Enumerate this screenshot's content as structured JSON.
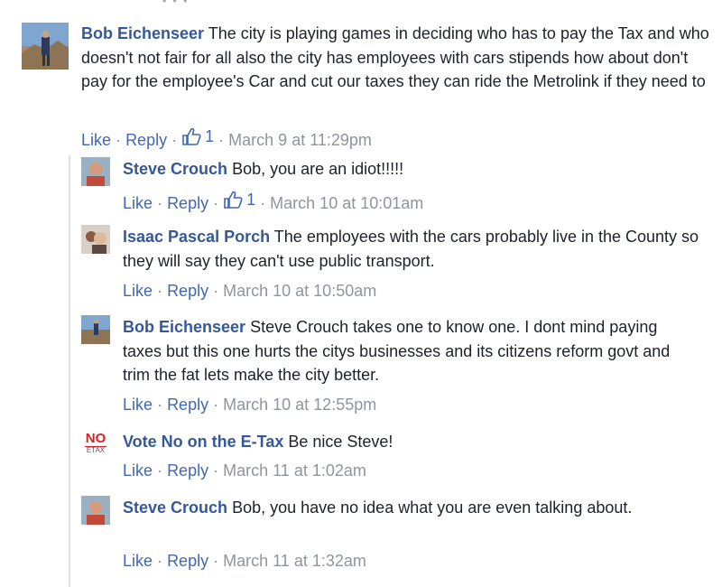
{
  "comments": [
    {
      "name": "Bob Eichenseer",
      "text": "The city is playing games in deciding who has to pay the Tax and who doesn't not fair for all also the city has employees with cars stipends how about don't pay for the employee's Car and cut our taxes they can ride the Metrolink if they need to",
      "like": "Like",
      "reply": "Reply",
      "reactions": "1",
      "time": "March 9 at 11:29pm"
    }
  ],
  "replies": [
    {
      "name": "Steve Crouch",
      "text": "Bob, you are an idiot!!!!!",
      "like": "Like",
      "reply": "Reply",
      "reactions": "1",
      "time": "March 10 at 10:01am"
    },
    {
      "name": "Isaac Pascal Porch",
      "text": "The employees with the cars probably live in the County so they will say they can't use public transport.",
      "like": "Like",
      "reply": "Reply",
      "time": "March 10 at 10:50am"
    },
    {
      "name": "Bob Eichenseer",
      "text": "Steve Crouch takes one to know one. I dont mind paying taxes but this one hurts the citys businesses and its citizens reform govt and trim the fat lets make the city better.",
      "like": "Like",
      "reply": "Reply",
      "time": "March 10 at 12:55pm"
    },
    {
      "name": "Vote No on the E-Tax",
      "text": "Be nice Steve!",
      "like": "Like",
      "reply": "Reply",
      "time": "March 11 at 1:02am",
      "logo": {
        "top": "NO",
        "bottom": "ETAX"
      }
    },
    {
      "name": "Steve Crouch",
      "text": "Bob, you have no idea what you are even talking about.",
      "like": "Like",
      "reply": "Reply",
      "time": "March 11 at 1:32am"
    }
  ],
  "separator": "·",
  "colors": {
    "name": "#365899",
    "link": "#4267b2",
    "meta": "#90949c",
    "text": "#1d2129"
  }
}
